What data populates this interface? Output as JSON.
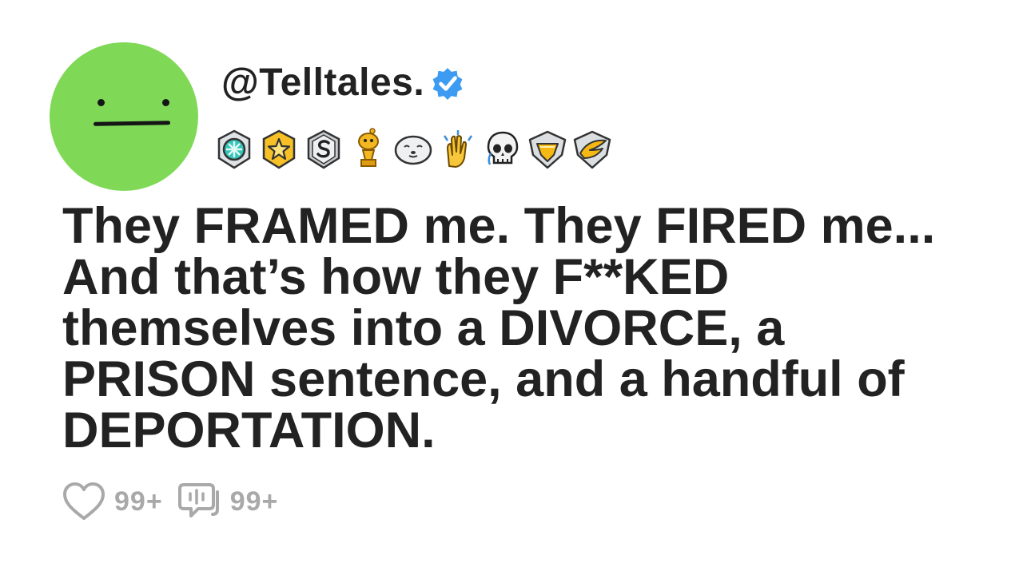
{
  "post": {
    "handle": "@Telltales.",
    "verified": true,
    "badges": [
      "helpful-medal-icon",
      "star-medal-icon",
      "s-medal-icon",
      "trophy-snoo-icon",
      "seal-icon",
      "clap-hands-icon",
      "skull-icon",
      "gold-diamond-badge-icon",
      "wing-shield-badge-icon"
    ],
    "title_lines": [
      "They FRAMED me. They FIRED me...",
      "And that’s how they F**KED",
      "themselves into a DIVORCE, a",
      "PRISON sentence, and a handful of",
      "DEPORTATION."
    ],
    "likes": "99+",
    "comments": "99+"
  },
  "colors": {
    "avatar": "#7fd957",
    "verified": "#3d9bf2",
    "text": "#222222",
    "stats": "#a9a9a9"
  }
}
